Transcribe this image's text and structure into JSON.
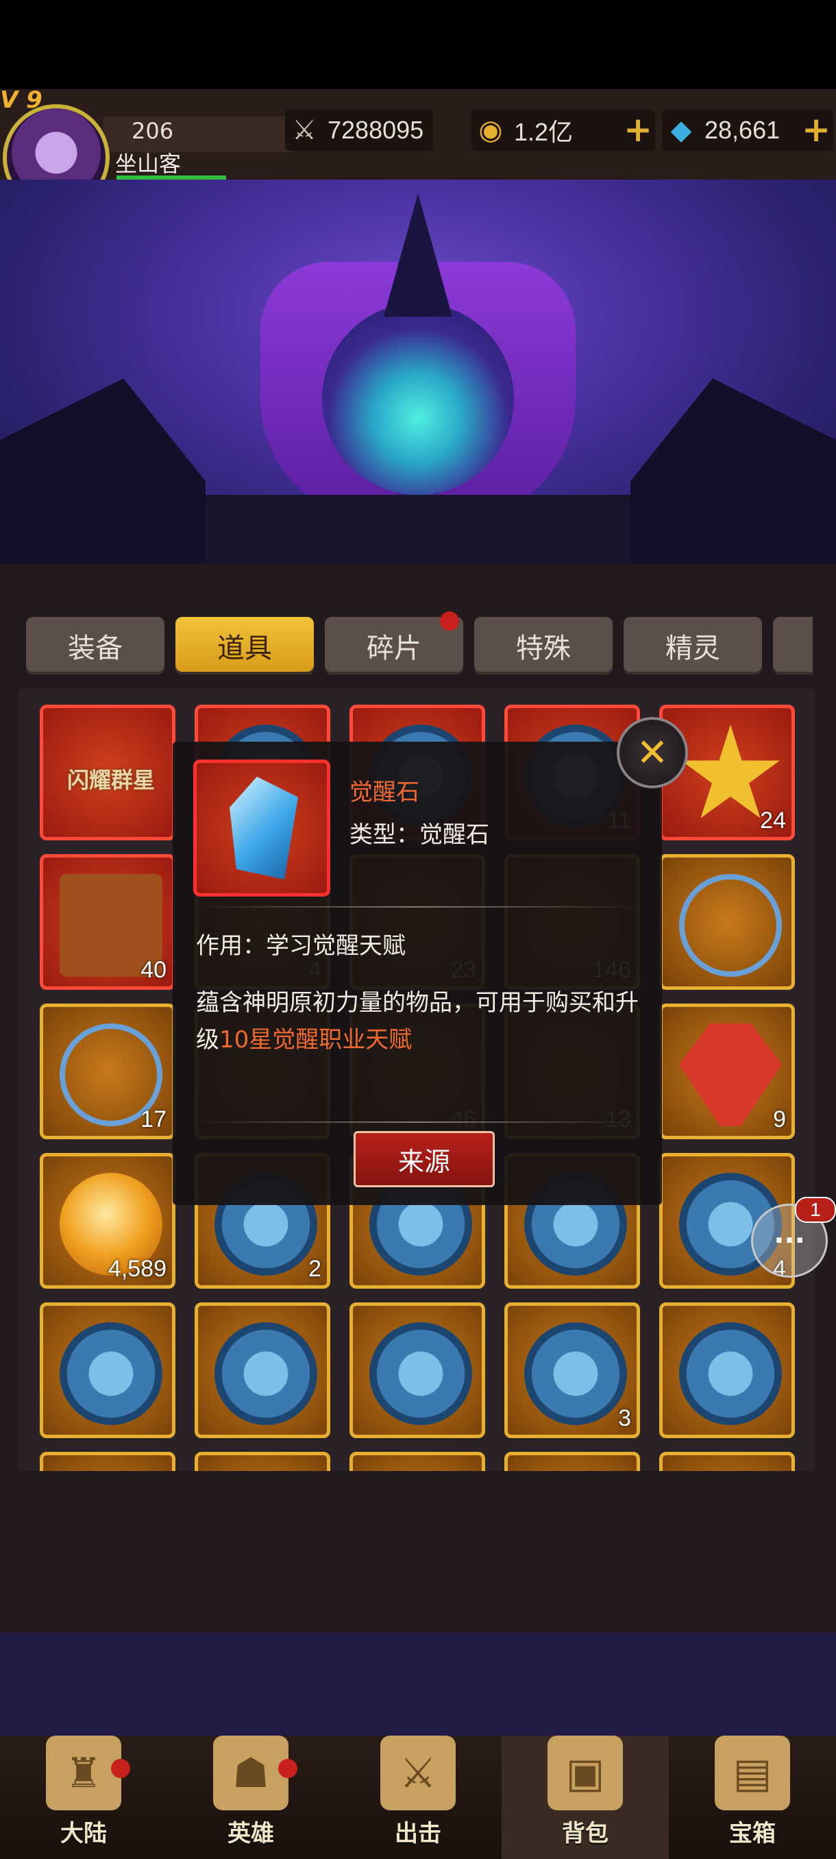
{
  "header": {
    "vip": "V 9",
    "level": "206",
    "player_name": "坐山客",
    "power": "7288095",
    "gold": "1.2亿",
    "gems": "28,661",
    "plus": "+"
  },
  "tabs": [
    {
      "label": "装备",
      "active": false
    },
    {
      "label": "道具",
      "active": true
    },
    {
      "label": "碎片",
      "active": false,
      "badge": true
    },
    {
      "label": "特殊",
      "active": false
    },
    {
      "label": "精灵",
      "active": false
    }
  ],
  "grid": {
    "rows": [
      [
        {
          "label": "闪耀群星"
        },
        {
          "count": ""
        },
        {
          "count": ""
        },
        {
          "count": "11"
        },
        {
          "count": "24"
        }
      ],
      [
        {
          "count": "40"
        },
        {
          "count": "4"
        },
        {
          "count": "23"
        },
        {
          "count": "146"
        },
        {
          "count": ""
        }
      ],
      [
        {
          "count": "17"
        },
        {
          "count": ""
        },
        {
          "count": "46"
        },
        {
          "count": "13"
        },
        {
          "count": "9"
        }
      ],
      [
        {
          "count": "4,589"
        },
        {
          "count": "2"
        },
        {
          "count": ""
        },
        {
          "count": ""
        },
        {
          "count": "4"
        }
      ],
      [
        {
          "count": ""
        },
        {
          "count": ""
        },
        {
          "count": ""
        },
        {
          "count": "3"
        },
        {
          "count": ""
        }
      ]
    ]
  },
  "tooltip": {
    "name": "觉醒石",
    "type": "类型：觉醒石",
    "use": "作用：学习觉醒天赋",
    "desc_prefix": "蕴含神明原初力量的物品，可用于购买和升级",
    "desc_highlight": "10星觉醒职业天赋",
    "source_button": "来源"
  },
  "chat": {
    "badge": "1"
  },
  "nav": [
    {
      "label": "大陆",
      "dot": true
    },
    {
      "label": "英雄",
      "dot": true
    },
    {
      "label": "出击",
      "dot": false
    },
    {
      "label": "背包",
      "dot": false,
      "active": true
    },
    {
      "label": "宝箱",
      "dot": false
    }
  ],
  "colors": {
    "accent_gold": "#e8b030",
    "highlight_orange": "#f06a30",
    "rare_red": "#ff4a3a"
  }
}
